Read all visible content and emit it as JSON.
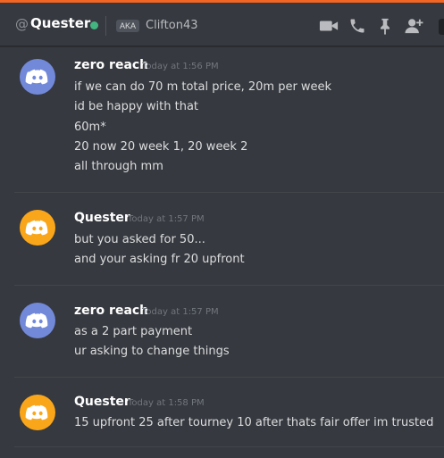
{
  "header": {
    "at_symbol": "@",
    "username": "Quester",
    "status_color": "#43b581",
    "aka_badge": "AKA",
    "alias": "Clifton43",
    "icons": [
      "video-call-icon",
      "voice-call-icon",
      "pin-icon",
      "add-friend-icon"
    ]
  },
  "messages": [
    {
      "author": "zero reach",
      "timestamp": "Today at 1:56 PM",
      "avatar_color": "#7289da",
      "lines": [
        "if we can do 70 m total price, 20m per week",
        "id be happy with that",
        "60m*",
        "20 now 20 week 1, 20 week 2",
        "all through mm"
      ]
    },
    {
      "author": "Quester",
      "timestamp": "Today at 1:57 PM",
      "avatar_color": "#faa61a",
      "lines": [
        "but you asked for 50...",
        "and your asking fr 20 upfront"
      ]
    },
    {
      "author": "zero reach",
      "timestamp": "Today at 1:57 PM",
      "avatar_color": "#7289da",
      "lines": [
        "as a 2 part payment",
        "ur asking to change things"
      ]
    },
    {
      "author": "Quester",
      "timestamp": "Today at 1:58 PM",
      "avatar_color": "#faa61a",
      "lines": [
        "15 upfront 25 after tourney 10 after thats fair offer im trusted"
      ]
    }
  ]
}
